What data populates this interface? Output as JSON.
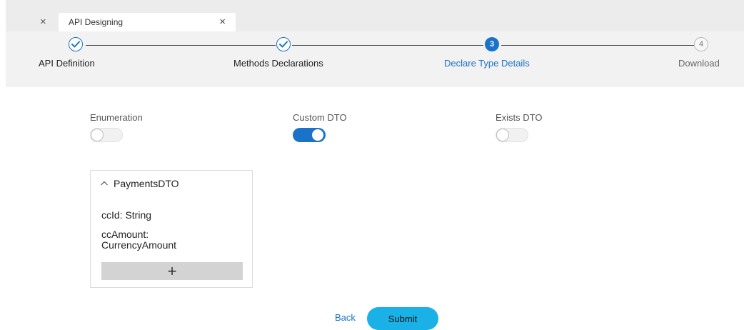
{
  "tabs": {
    "close_left": "×",
    "title": "API Designing",
    "close": "×"
  },
  "stepper": {
    "steps": [
      {
        "label": "API Definition",
        "number": "",
        "state": "done"
      },
      {
        "label": "Methods Declarations",
        "number": "",
        "state": "done"
      },
      {
        "label": "Declare Type Details",
        "number": "3",
        "state": "active"
      },
      {
        "label": "Download",
        "number": "4",
        "state": "future"
      }
    ]
  },
  "toggles": [
    {
      "label": "Enumeration",
      "on": false
    },
    {
      "label": "Custom DTO",
      "on": true
    },
    {
      "label": "Exists DTO",
      "on": false
    }
  ],
  "dto": {
    "name": "PaymentsDTO",
    "fields": [
      {
        "line1": "ccId: String",
        "line2": ""
      },
      {
        "line1": "ccAmount:",
        "line2": "CurrencyAmount"
      }
    ],
    "add_label": "+"
  },
  "actions": {
    "back_label": "Back",
    "submit_label": "Submit"
  },
  "colors": {
    "accent": "#1a73c8",
    "submit": "#1ab1e6"
  }
}
